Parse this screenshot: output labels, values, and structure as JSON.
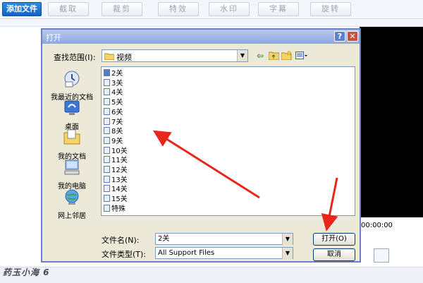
{
  "toolbar": {
    "add_file": "添加文件",
    "clip": "截取",
    "crop": "裁剪",
    "effects": "特效",
    "watermark": "水印",
    "subtitle": "字幕",
    "rotate": "旋转"
  },
  "preview": {
    "time": "00:00:00"
  },
  "dialog": {
    "title": "打开",
    "lookin_label": "查找范围(I):",
    "lookin_value": "视频",
    "filename_label": "文件名(N):",
    "filename_value": "2关",
    "filetype_label": "文件类型(T):",
    "filetype_value": "All Support Files",
    "open_label": "打开(O)",
    "cancel_label": "取消"
  },
  "places": [
    {
      "label": "我最近的文档",
      "icon": "recent-documents-icon"
    },
    {
      "label": "桌面",
      "icon": "desktop-icon"
    },
    {
      "label": "我的文档",
      "icon": "my-documents-icon"
    },
    {
      "label": "我的电脑",
      "icon": "my-computer-icon"
    },
    {
      "label": "网上邻居",
      "icon": "network-places-icon"
    }
  ],
  "files": [
    "2关",
    "3关",
    "4关",
    "5关",
    "6关",
    "7关",
    "8关",
    "9关",
    "10关",
    "11关",
    "12关",
    "13关",
    "14关",
    "15关",
    "特殊"
  ],
  "footer": {
    "watermark": "药玉小海 6"
  },
  "colors": {
    "annotation_arrow": "#e8261c",
    "primary_button": "#1263c9",
    "titlebar": "#8ea8df"
  }
}
